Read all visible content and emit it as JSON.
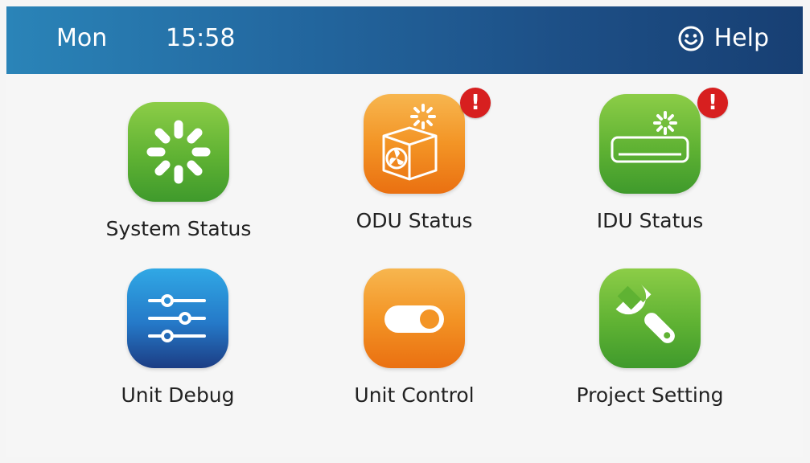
{
  "header": {
    "day": "Mon",
    "time": "15:58",
    "help_label": "Help",
    "help_icon": "smiley-face-icon"
  },
  "tiles": [
    {
      "label": "System Status",
      "icon": "loading-spinner-icon",
      "color": "#5fb233",
      "alert": false
    },
    {
      "label": "ODU Status",
      "icon": "outdoor-unit-fan-icon",
      "color": "#f39425",
      "alert": true,
      "alert_text": "!"
    },
    {
      "label": "IDU Status",
      "icon": "indoor-unit-ac-icon",
      "color": "#5fb233",
      "alert": true,
      "alert_text": "!"
    },
    {
      "label": "Unit Debug",
      "icon": "sliders-icon",
      "color": "#2579c8",
      "alert": false
    },
    {
      "label": "Unit Control",
      "icon": "toggle-switch-icon",
      "color": "#f39425",
      "alert": false
    },
    {
      "label": "Project Setting",
      "icon": "wrench-icon",
      "color": "#5fb233",
      "alert": false
    }
  ],
  "colors": {
    "header_start": "#2a84b8",
    "header_end": "#173f73",
    "alert_badge": "#d71f1f"
  }
}
